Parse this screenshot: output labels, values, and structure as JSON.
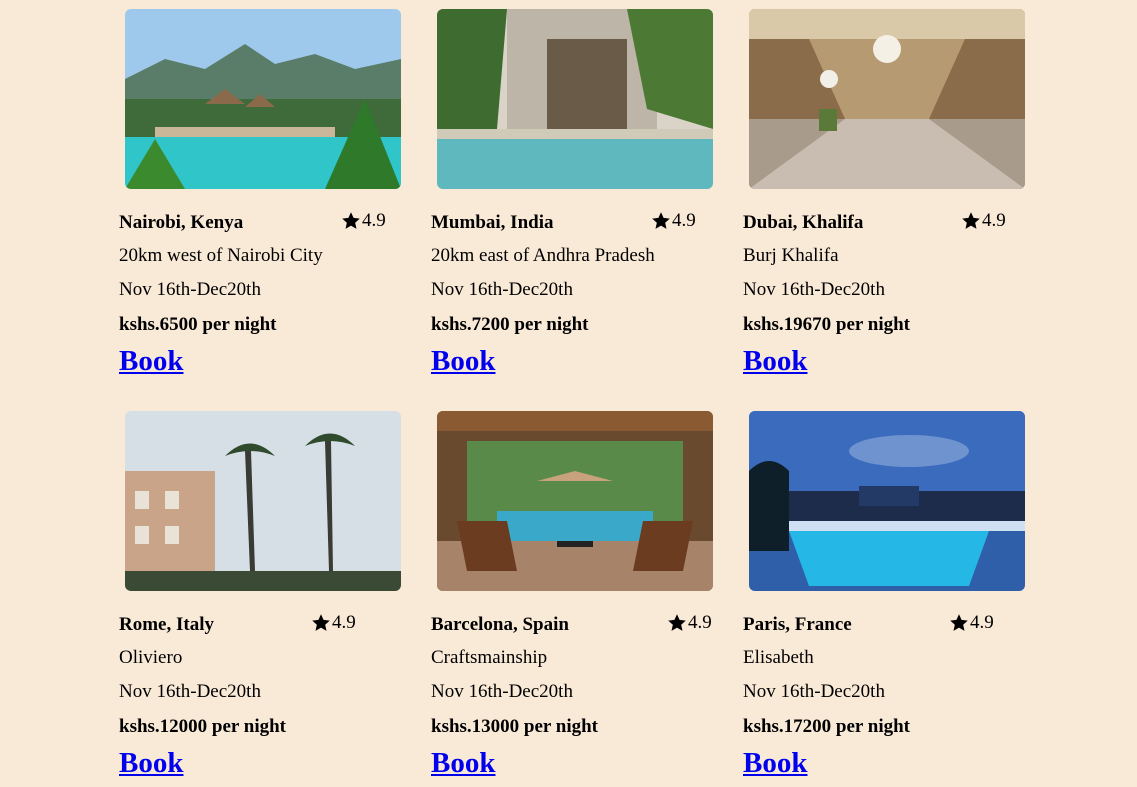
{
  "listings": [
    {
      "location": "Nairobi, Kenya",
      "rating": "4.9",
      "description": "20km west of Nairobi City",
      "dates": "Nov 16th-Dec20th",
      "price": "kshs.6500 per night",
      "book_label": "Book"
    },
    {
      "location": "Mumbai, India",
      "rating": "4.9",
      "description": "20km east of Andhra Pradesh",
      "dates": "Nov 16th-Dec20th",
      "price": "kshs.7200 per night",
      "book_label": "Book"
    },
    {
      "location": "Dubai, Khalifa",
      "rating": "4.9",
      "description": "Burj Khalifa",
      "dates": "Nov 16th-Dec20th",
      "price": "kshs.19670 per night",
      "book_label": "Book"
    },
    {
      "location": "Rome, Italy",
      "rating": "4.9",
      "description": "Oliviero",
      "dates": "Nov 16th-Dec20th",
      "price": "kshs.12000 per night",
      "book_label": "Book"
    },
    {
      "location": "Barcelona, Spain",
      "rating": "4.9",
      "description": "Craftsmainship",
      "dates": "Nov 16th-Dec20th",
      "price": "kshs.13000 per night",
      "book_label": "Book"
    },
    {
      "location": "Paris, France",
      "rating": "4.9",
      "description": "Elisabeth",
      "dates": "Nov 16th-Dec20th",
      "price": "kshs.17200 per night",
      "book_label": "Book"
    }
  ],
  "icons": {
    "rating": "star-icon"
  },
  "colors": {
    "background": "#f9e9d7",
    "link": "#0000ee"
  }
}
